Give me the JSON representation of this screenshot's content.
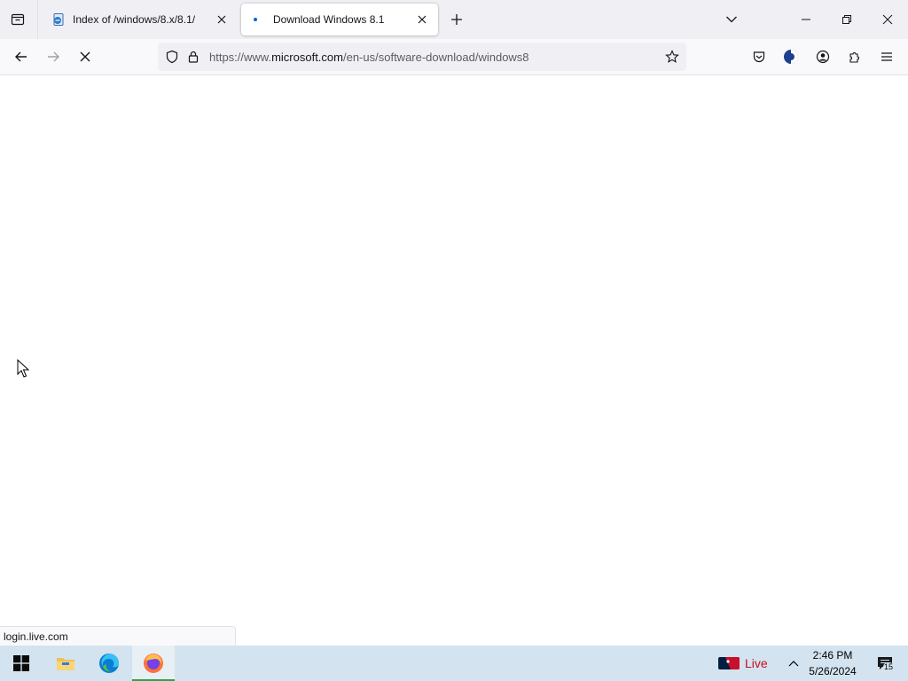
{
  "browser": {
    "tabs": [
      {
        "title": "Index of /windows/8.x/8.1/",
        "icon": "ie-page-icon",
        "active": false
      },
      {
        "title": "Download Windows 8.1",
        "icon": "loading-dot-icon",
        "active": true
      }
    ],
    "url": {
      "prefix": "https://www.",
      "domain": "microsoft.com",
      "path": "/en-us/software-download/windows8"
    },
    "status_text": "login.live.com",
    "loading": true
  },
  "taskbar": {
    "apps": [
      "start",
      "file-explorer",
      "edge",
      "firefox"
    ],
    "active_app": "firefox",
    "live_label": "Live",
    "time": "2:46 PM",
    "date": "5/26/2024",
    "notification_count": "15"
  },
  "colors": {
    "accent_blue": "#0060df",
    "live_red": "#c50f1f",
    "taskbar_bg": "#d3e3ef",
    "active_indicator": "#2da44e"
  }
}
